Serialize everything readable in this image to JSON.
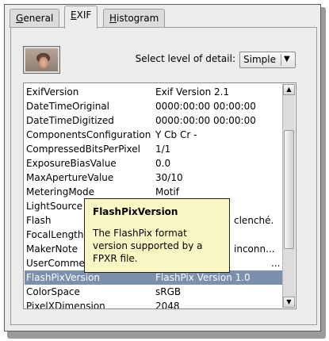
{
  "tabs": [
    {
      "pre": "",
      "ul": "G",
      "post": "eneral"
    },
    {
      "pre": "",
      "ul": "E",
      "post": "XIF"
    },
    {
      "pre": "",
      "ul": "H",
      "post": "istogram"
    }
  ],
  "detail": {
    "label": "Select level of detail:",
    "value": "Simple"
  },
  "exif_rows": [
    {
      "key": "ExifVersion",
      "value": "Exif Version 2.1"
    },
    {
      "key": "DateTimeOriginal",
      "value": "0000:00:00 00:00:00"
    },
    {
      "key": "DateTimeDigitized",
      "value": "0000:00:00 00:00:00"
    },
    {
      "key": "ComponentsConfiguration",
      "value": "Y Cb Cr -"
    },
    {
      "key": "CompressedBitsPerPixel",
      "value": "1/1"
    },
    {
      "key": "ExposureBiasValue",
      "value": "0.0"
    },
    {
      "key": "MaxApertureValue",
      "value": "30/10"
    },
    {
      "key": "MeteringMode",
      "value": "Motif"
    },
    {
      "key": "LightSource",
      "value": ""
    },
    {
      "key": "Flash",
      "value": "clenché."
    },
    {
      "key": "FocalLength",
      "value": ""
    },
    {
      "key": "MakerNote",
      "value": "inconn..."
    },
    {
      "key": "UserComme",
      "value": "..."
    },
    {
      "key": "FlashPixVersion",
      "value": "FlashPix Version 1.0"
    },
    {
      "key": "ColorSpace",
      "value": "sRGB"
    },
    {
      "key": "PixelXDimension",
      "value": "2048"
    }
  ],
  "tooltip": {
    "title": "FlashPixVersion",
    "lines": [
      "The FlashPix format",
      "version supported by a",
      "FPXR file."
    ]
  }
}
